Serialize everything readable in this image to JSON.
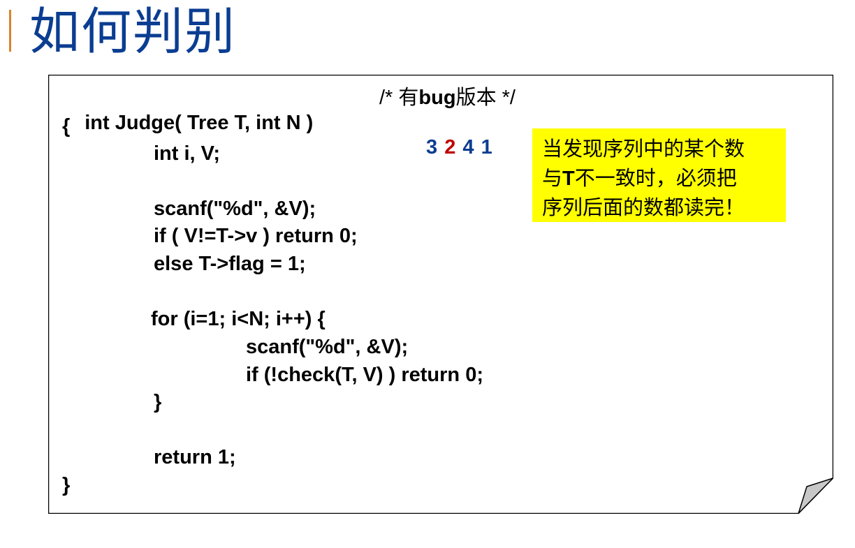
{
  "slide": {
    "title": "如何判别"
  },
  "code": {
    "line1": "int Judge( Tree T, int N )",
    "comment_open": "/* 有",
    "comment_bug": "bug",
    "comment_close": "版本 */",
    "line2": "{",
    "line3": "int i, V;",
    "line4": "scanf(\"%d\", &V);",
    "line5": "if ( V!=T->v ) return 0;",
    "line6": "else T->flag = 1;",
    "line7": "for (i=1; i<N; i++) {",
    "line8": "scanf(\"%d\", &V);",
    "line9": "if (!check(T, V) ) return 0;",
    "line10": "}",
    "line11": "return 1;",
    "line12": "}"
  },
  "sequence": {
    "items": [
      "3",
      "2",
      "4",
      "1"
    ],
    "colors": [
      "#0b3d91",
      "#c00000",
      "#0b3d91",
      "#0b3d91"
    ]
  },
  "note": {
    "line1": "当发现序列中的某个数",
    "line2_pre": "与",
    "line2_bold": "T",
    "line2_post": "不一致时，必须把",
    "line3": "序列后面的数都读完！"
  },
  "colors": {
    "title": "#0b3d91",
    "accent": "#d9822b",
    "note_bg": "#ffff00"
  }
}
